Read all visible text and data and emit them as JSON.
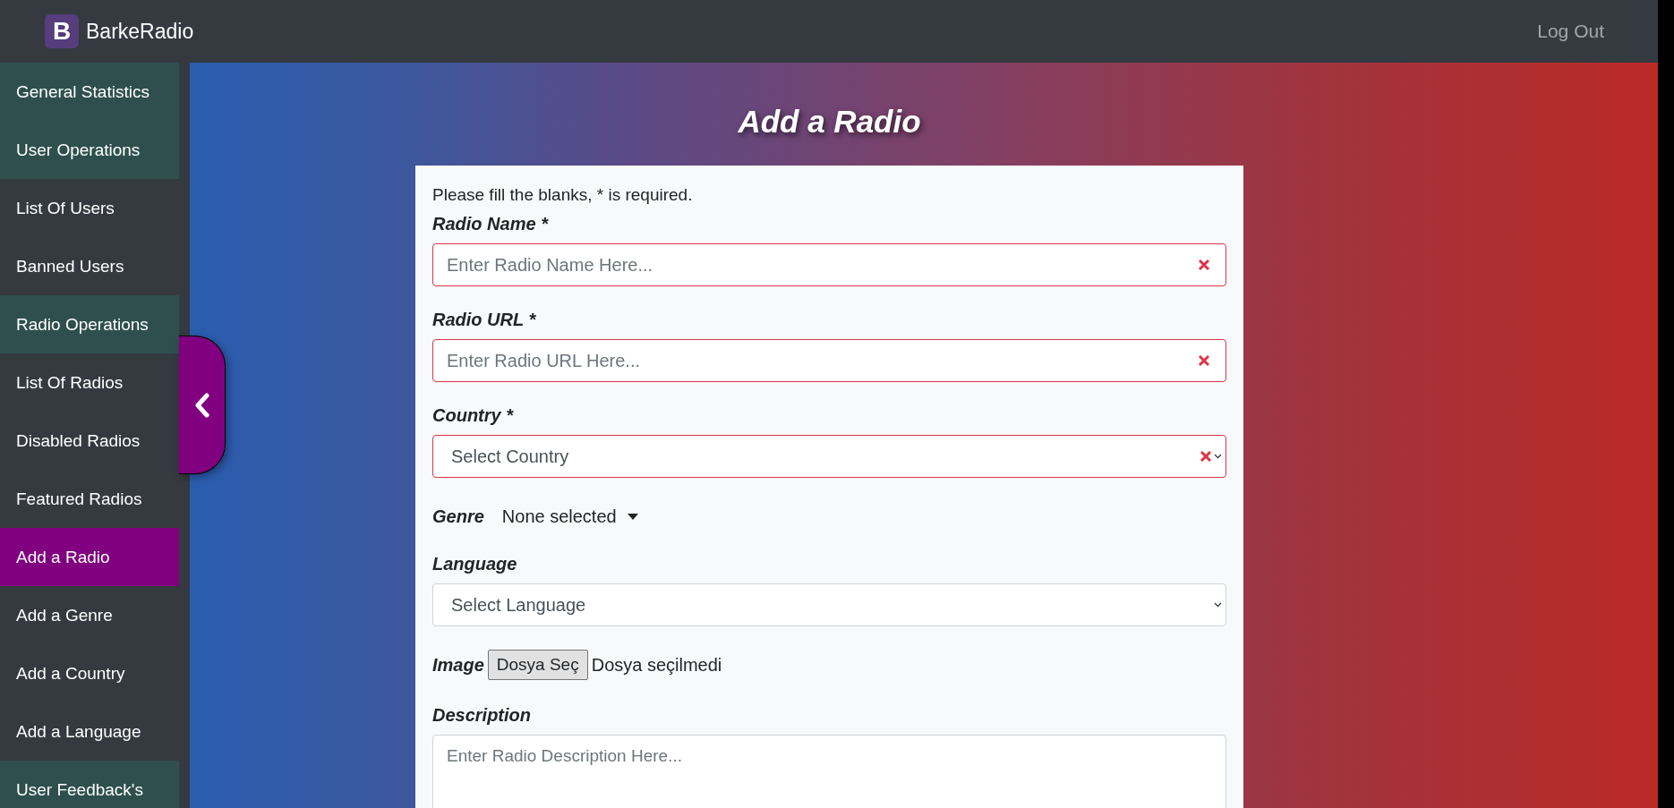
{
  "navbar": {
    "logo_letter": "B",
    "brand": "BarkeRadio",
    "logout": "Log Out"
  },
  "sidebar": {
    "items": [
      {
        "label": "General Statistics",
        "kind": "section",
        "selected": false
      },
      {
        "label": "User Operations",
        "kind": "section",
        "selected": false
      },
      {
        "label": "List Of Users",
        "kind": "link",
        "selected": false
      },
      {
        "label": "Banned Users",
        "kind": "link",
        "selected": false
      },
      {
        "label": "Radio Operations",
        "kind": "section",
        "selected": false
      },
      {
        "label": "List Of Radios",
        "kind": "link",
        "selected": false
      },
      {
        "label": "Disabled Radios",
        "kind": "link",
        "selected": false
      },
      {
        "label": "Featured Radios",
        "kind": "link",
        "selected": false
      },
      {
        "label": "Add a Radio",
        "kind": "link",
        "selected": true
      },
      {
        "label": "Add a Genre",
        "kind": "link",
        "selected": false
      },
      {
        "label": "Add a Country",
        "kind": "link",
        "selected": false
      },
      {
        "label": "Add a Language",
        "kind": "link",
        "selected": false
      },
      {
        "label": "User Feedback's",
        "kind": "section",
        "selected": false
      }
    ]
  },
  "page_title": "Add a Radio",
  "form": {
    "note": "Please fill the blanks, * is required.",
    "fields": [
      {
        "kind": "text",
        "label": "Radio Name *",
        "placeholder": "Enter Radio Name Here...",
        "invalid": true
      },
      {
        "kind": "text",
        "label": "Radio URL *",
        "placeholder": "Enter Radio URL Here...",
        "invalid": true
      },
      {
        "kind": "select",
        "label": "Country *",
        "value": "Select Country",
        "invalid": true
      },
      {
        "kind": "multiselect",
        "label": "Genre",
        "value": "None selected"
      },
      {
        "kind": "select",
        "label": "Language",
        "value": "Select Language",
        "invalid": false
      },
      {
        "kind": "file",
        "label": "Image",
        "button": "Dosya Seç",
        "status": "Dosya seçilmedi"
      },
      {
        "kind": "textarea",
        "label": "Description",
        "placeholder": "Enter Radio Description Here..."
      }
    ]
  }
}
